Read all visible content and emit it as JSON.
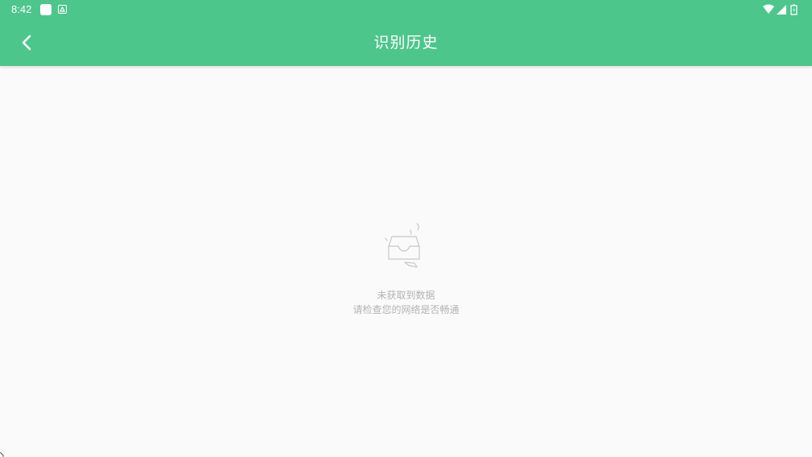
{
  "status_bar": {
    "time": "8:42",
    "icons": [
      "notification-square-icon",
      "notification-app-icon",
      "wifi-icon",
      "cellular-signal-icon",
      "battery-icon"
    ]
  },
  "app_bar": {
    "back_icon": "chevron-left-icon",
    "title": "识别历史"
  },
  "empty_state": {
    "illustration": "empty-inbox-icon",
    "line1": "未获取到数据",
    "line2": "请检查您的网络是否畅通"
  },
  "colors": {
    "primary": "#4dc68c",
    "background": "#fafafa",
    "hint_text": "#b3b3b3"
  }
}
